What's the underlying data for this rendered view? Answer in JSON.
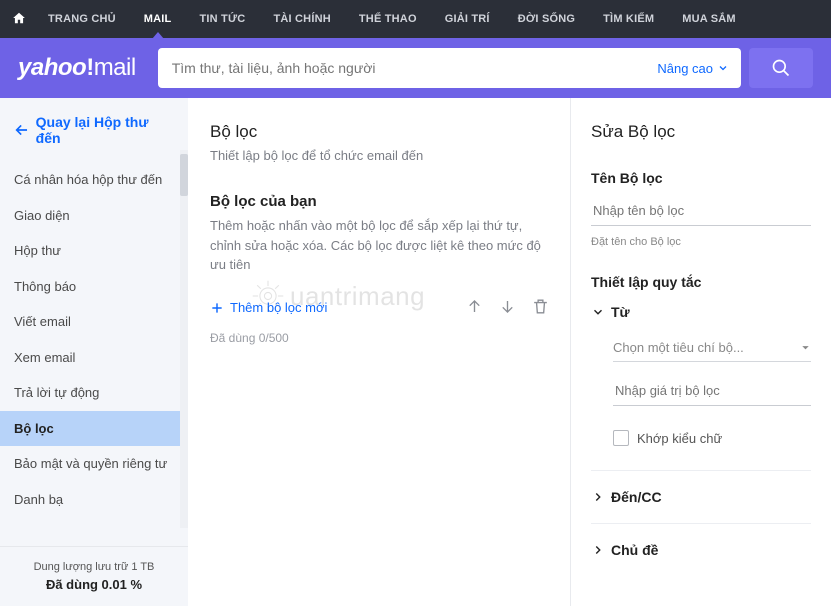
{
  "topnav": {
    "items": [
      {
        "label": "TRANG CHỦ"
      },
      {
        "label": "MAIL",
        "active": true
      },
      {
        "label": "TIN TỨC"
      },
      {
        "label": "TÀI CHÍNH"
      },
      {
        "label": "THỂ THAO"
      },
      {
        "label": "GIẢI TRÍ"
      },
      {
        "label": "ĐỜI SỐNG"
      },
      {
        "label": "TÌM KIẾM"
      },
      {
        "label": "MUA SẮM"
      }
    ]
  },
  "logo": {
    "brand": "yahoo",
    "product": "mail"
  },
  "search": {
    "placeholder": "Tìm thư, tài liệu, ảnh hoặc người",
    "advanced_label": "Nâng cao"
  },
  "sidebar": {
    "back_label": "Quay lại Hộp thư đến",
    "items": [
      {
        "label": "Cá nhân hóa hộp thư đến"
      },
      {
        "label": "Giao diện"
      },
      {
        "label": "Hộp thư"
      },
      {
        "label": "Thông báo"
      },
      {
        "label": "Viết email"
      },
      {
        "label": "Xem email"
      },
      {
        "label": "Trả lời tự động"
      },
      {
        "label": "Bộ lọc",
        "active": true
      },
      {
        "label": "Bảo mật và quyền riêng tư"
      },
      {
        "label": "Danh bạ"
      }
    ],
    "storage_label": "Dung lượng lưu trữ 1 TB",
    "storage_used": "Đã dùng 0.01 %"
  },
  "main": {
    "title": "Bộ lọc",
    "subtitle": "Thiết lập bộ lọc để tổ chức email đến",
    "your_filters_title": "Bộ lọc của bạn",
    "your_filters_desc": "Thêm hoặc nhấn vào một bộ lọc để sắp xếp lại thứ tự, chỉnh sửa hoặc xóa. Các bộ lọc được liệt kê theo mức độ ưu tiên",
    "add_filter_label": "Thêm bộ lọc mới",
    "counter": "Đã dùng 0/500"
  },
  "right": {
    "title": "Sửa Bộ lọc",
    "name_label": "Tên Bộ lọc",
    "name_placeholder": "Nhập tên bộ lọc",
    "name_helper": "Đặt tên cho Bộ lọc",
    "rules_label": "Thiết lập quy tắc",
    "sections": [
      {
        "label": "Từ",
        "expanded": true
      },
      {
        "label": "Đến/CC",
        "expanded": false
      },
      {
        "label": "Chủ đề",
        "expanded": false
      }
    ],
    "criteria_placeholder": "Chọn một tiêu chí bộ...",
    "value_placeholder": "Nhập giá trị bộ lọc",
    "match_case_label": "Khớp kiểu chữ"
  },
  "watermark": "uantrimang"
}
